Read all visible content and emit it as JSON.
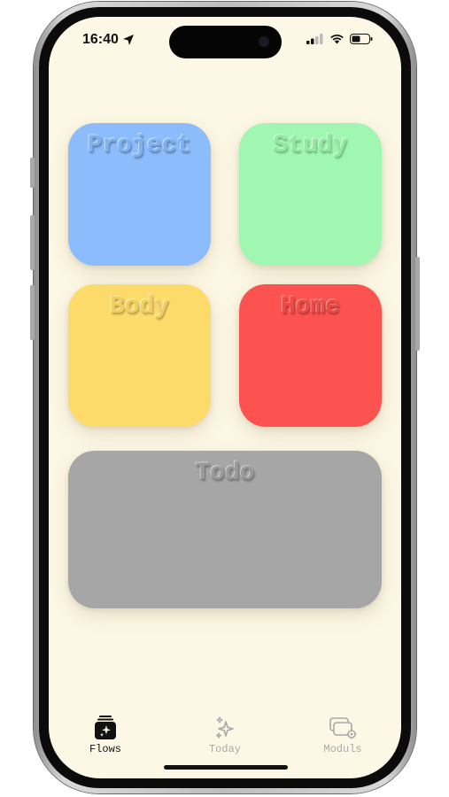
{
  "status_bar": {
    "time": "16:40",
    "icons": [
      "location-arrow-icon",
      "cellular-signal-icon",
      "wifi-icon",
      "battery-icon"
    ]
  },
  "tiles": {
    "project": {
      "label": "Project",
      "color": "#8cbcfb"
    },
    "study": {
      "label": "Study",
      "color": "#a0f7b1"
    },
    "body": {
      "label": "Body",
      "color": "#fddb6b"
    },
    "home": {
      "label": "Home",
      "color": "#fd5350"
    },
    "todo": {
      "label": "Todo",
      "color": "#a6a6a6"
    }
  },
  "tab_bar": {
    "tabs": [
      {
        "label": "Flows",
        "icon": "flows-icon",
        "selected": true
      },
      {
        "label": "Today",
        "icon": "sparkles-icon",
        "selected": false
      },
      {
        "label": "Moduls",
        "icon": "moduls-icon",
        "selected": false
      }
    ],
    "active_color": "#111111",
    "inactive_color": "#a8a8a8"
  },
  "colors": {
    "background": "#fdf8e6"
  }
}
